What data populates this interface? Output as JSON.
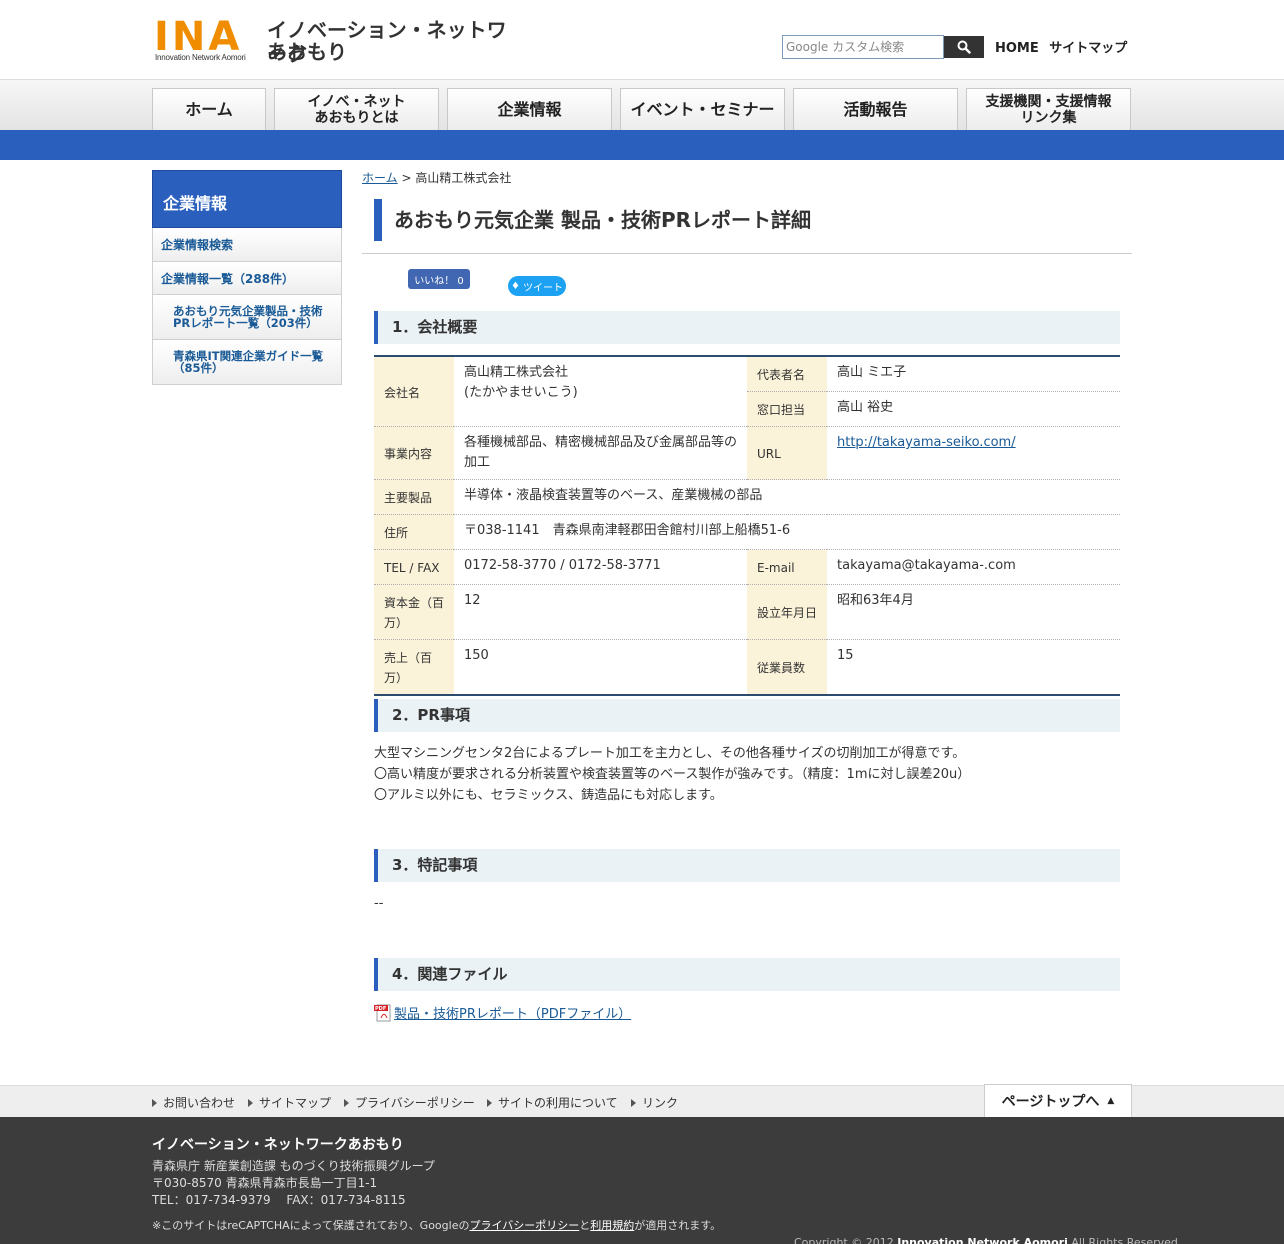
{
  "header": {
    "logo_ina": "INA",
    "logo_sub": "Innovation Network Aomori",
    "logo_jp_line1": "イノベーション・ネットワーク",
    "logo_jp_line2": "あおもり",
    "search_placeholder": "カスタム検索",
    "search_brand": "Google",
    "link_home": "HOME",
    "link_sitemap": "サイトマップ"
  },
  "nav": [
    "ホーム",
    "イノベ・ネット\nあおもりとは",
    "企業情報",
    "イベント・セミナー",
    "活動報告",
    "支援機関・支援情報\nリンク集"
  ],
  "sidebar": {
    "title": "企業情報",
    "items": [
      "企業情報検索",
      "企業情報一覧（288件）",
      "あおもり元気企業製品・技術PRレポート一覧（203件）",
      "青森県IT関連企業ガイド一覧（85件）"
    ]
  },
  "breadcrumb": {
    "home": "ホーム",
    "separator": ">",
    "current": "高山精工株式会社"
  },
  "page_title": "あおもり元気企業 製品・技術PRレポート詳細",
  "social": {
    "fb_label": "いいね！ 0",
    "tw_label": "ツイート"
  },
  "sections": {
    "s1": "1．会社概要",
    "s2": "2．PR事項",
    "s3": "3．特記事項",
    "s4": "4．関連ファイル"
  },
  "company": {
    "name_label": "会社名",
    "name": "高山精工株式会社",
    "name_kana": "(たかやませいこう)",
    "rep_label": "代表者名",
    "rep": "高山 ミエ子",
    "contact_label": "窓口担当",
    "contact": "高山 裕史",
    "business_label": "事業内容",
    "business": "各種機械部品、精密機械部品及び金属部品等の加工",
    "url_label": "URL",
    "url": "http://takayama-seiko.com/",
    "products_label": "主要製品",
    "products": "半導体・液晶検査装置等のベース、産業機械の部品",
    "address_label": "住所",
    "address": "〒038-1141　青森県南津軽郡田舎館村川部上船橋51-6",
    "telfax_label": "TEL / FAX",
    "telfax": "0172-58-3770 / 0172-58-3771",
    "email_label": "E-mail",
    "email": "takayama@takayama-.com",
    "capital_label": "資本金（百万）",
    "capital": "12",
    "founded_label": "設立年月日",
    "founded": "昭和63年4月",
    "sales_label": "売上（百万）",
    "sales": "150",
    "employees_label": "従業員数",
    "employees": "15"
  },
  "pr": {
    "line1": "大型マシニングセンタ2台によるプレート加工を主力とし、その他各種サイズの切削加工が得意です。",
    "line2": "〇高い精度が要求される分析装置や検査装置等のベース製作が強みです。（精度：1mに対し誤差20u）",
    "line3": "〇アルミ以外にも、セラミックス、鋳造品にも対応します。"
  },
  "notes": "--",
  "file_link": "製品・技術PRレポート（PDFファイル）",
  "footer": {
    "links": [
      "お問い合わせ",
      "サイトマップ",
      "プライバシーポリシー",
      "サイトの利用について",
      "リンク"
    ],
    "pagetop": "ページトップへ",
    "org": "イノベーション・ネットワークあおもり",
    "addr1": "青森県庁 新産業創造課 ものづくり技術振興グループ",
    "addr2": "〒030-8570 青森県青森市長島一丁目1-1",
    "addr3": "TEL：017-734-9379　 FAX：017-734-8115",
    "recaptcha_pre": "※このサイトはreCAPTCHAによって保護されており、Googleの",
    "recaptcha_privacy": "プライバシーポリシー",
    "recaptcha_and": "と",
    "recaptcha_terms": "利用規約",
    "recaptcha_post": "が適用されます。",
    "copyright_pre": "Copyright © 2012 ",
    "copyright_org": "Innovation Network Aomori",
    "copyright_post": " All Rights Reserved."
  },
  "colors": {
    "brand_blue": "#2b5fbe",
    "logo_orange": "#f08c00",
    "label_bg": "#fbf3d9",
    "section_bg": "#eaf2f6",
    "footer_bg": "#3c3c3c"
  }
}
